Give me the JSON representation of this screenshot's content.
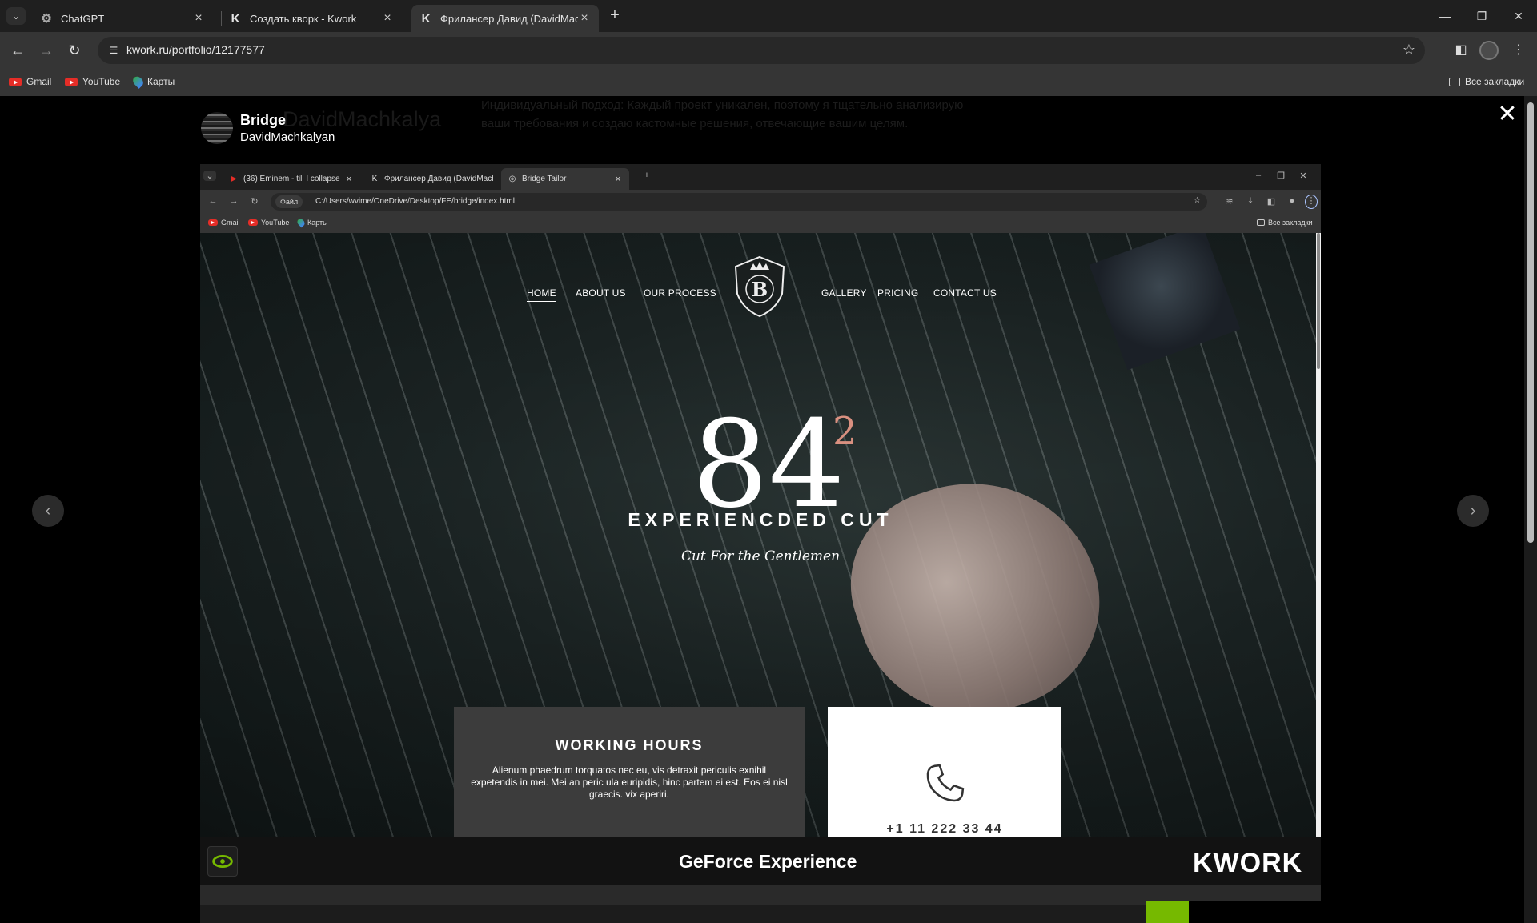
{
  "browser": {
    "tabs": [
      {
        "title": "ChatGPT",
        "icon": "chatgpt-icon"
      },
      {
        "title": "Создать кворк - Kwork",
        "icon": "kwork-icon"
      },
      {
        "title": "Фрилансер Давид (DavidMach",
        "icon": "kwork-icon",
        "active": true
      }
    ],
    "url": "kwork.ru/portfolio/12177577",
    "bookmarks": [
      "Gmail",
      "YouTube",
      "Карты"
    ],
    "all_bookmarks": "Все закладки"
  },
  "modal": {
    "title": "Bridge",
    "author": "DavidMachkalyan",
    "background_name": "DavidMachkalya",
    "background_text": "Индивидуальный подход: Каждый проект уникален, поэтому я тщательно анализирую ваши требования и создаю кастомные решения, отвечающие вашим целям.",
    "close": "✕",
    "prev": "‹",
    "next": "›"
  },
  "inner_browser": {
    "tabs": [
      {
        "title": "(36) Eminem - till I collapse",
        "icon": "youtube-icon"
      },
      {
        "title": "Фрилансер Давид (DavidMach",
        "icon": "kwork-icon"
      },
      {
        "title": "Bridge Tailor",
        "icon": "globe-icon",
        "active": true
      }
    ],
    "file_chip": "Файл",
    "url": "C:/Users/wvime/OneDrive/Desktop/FE/bridge/index.html",
    "bookmarks": [
      "Gmail",
      "YouTube",
      "Карты"
    ],
    "all_bookmarks": "Все закладки"
  },
  "site": {
    "nav_left": [
      "HOME",
      "ABOUT US",
      "OUR PROCESS"
    ],
    "nav_right": [
      "GALLERY",
      "PRICING",
      "CONTACT US"
    ],
    "logo_letter": "B",
    "big_number": "84",
    "superscript": "2",
    "headline": "EXPERIENCDED CUT",
    "tagline": "Cut For the Gentlemen",
    "hours_title": "WORKING HOURS",
    "hours_text": "Alienum phaedrum torquatos nec eu, vis detraxit periculis exnihil expetendis in mei. Mei an peric ula euripidis, hinc partem ei est. Eos ei nisl graecis. vix aperiri.",
    "phone_partial": "+1 11 222 33 44"
  },
  "overlay_bar": {
    "title": "GeForce Experience",
    "brand": "KWORK"
  },
  "colors": {
    "accent_sup": "#d99080",
    "nvidia_green": "#76b900"
  }
}
